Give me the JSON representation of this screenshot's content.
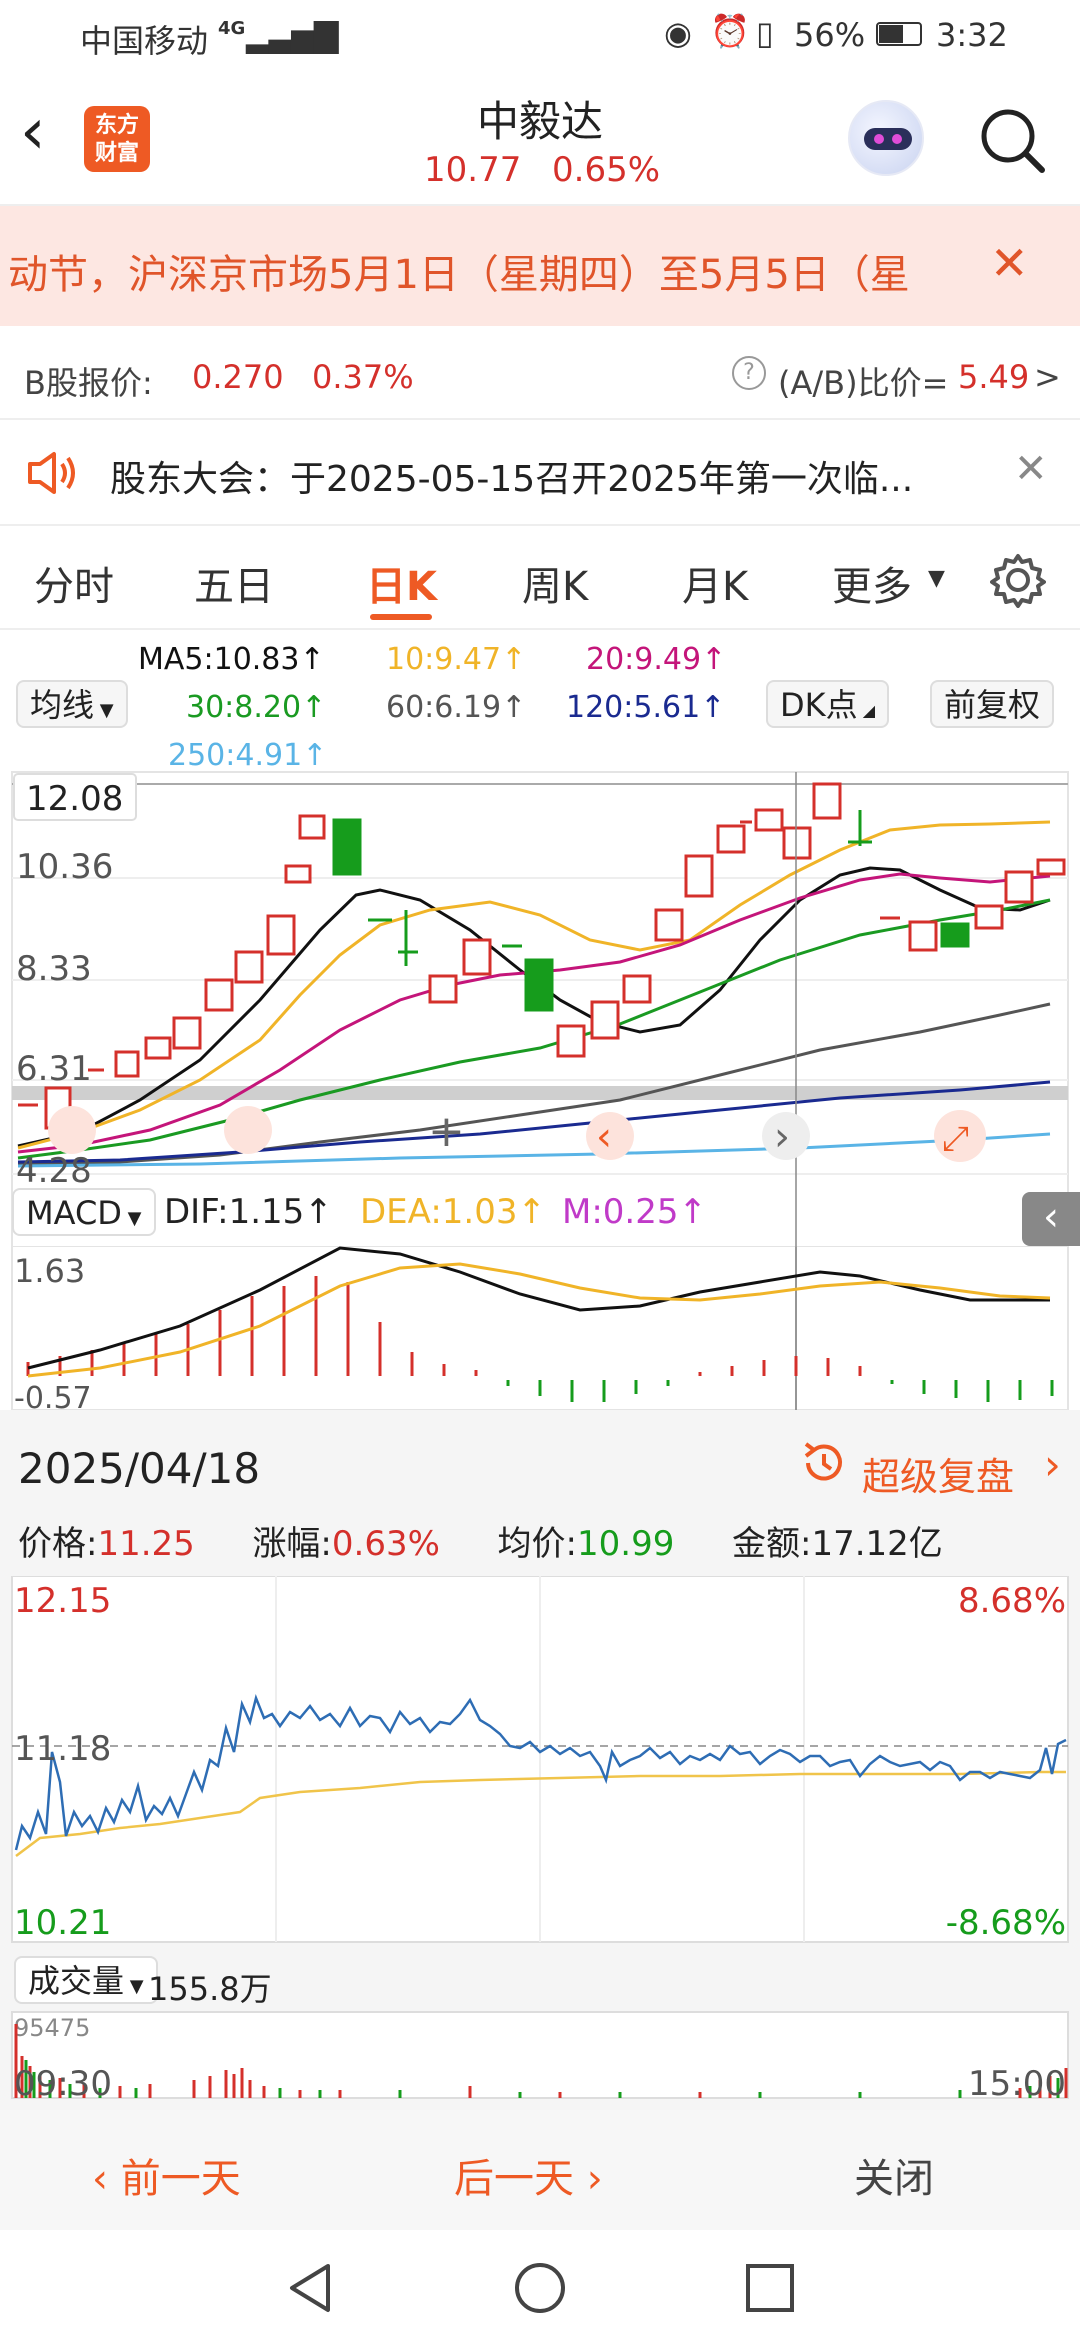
{
  "status": {
    "carrier": "中国移动",
    "network": "4G",
    "battery": "56%",
    "time": "3:32"
  },
  "header": {
    "title": "中毅达",
    "price": "10.77",
    "change_pct": "0.65%",
    "logo_text_1": "东方",
    "logo_text_2": "财富"
  },
  "notice": {
    "text": "动节，沪深京市场5月1日（星期四）至5月5日（星"
  },
  "bquote": {
    "label": "B股报价:",
    "price": "0.270",
    "pct": "0.37%",
    "ratio_label": "(A/B)比价=",
    "ratio_value": "5.49",
    "arrow": ">"
  },
  "meeting": {
    "text": "股东大会：于2025-05-15召开2025年第一次临..."
  },
  "tabs": [
    "分时",
    "五日",
    "日K",
    "周K",
    "月K",
    "更多"
  ],
  "active_tab": "日K",
  "ma": {
    "ma5": "MA5:10.83↑",
    "ma10": "10:9.47↑",
    "ma20": "20:9.49↑",
    "ma30": "30:8.20↑",
    "ma60": "60:6.19↑",
    "ma120": "120:5.61↑",
    "ma250": "250:4.91↑",
    "selector": "均线",
    "dk": "DK点",
    "adjust": "前复权"
  },
  "kline": {
    "y_labels": [
      "12.08",
      "10.36",
      "8.33",
      "6.31",
      "4.28"
    ]
  },
  "macd": {
    "label": "MACD",
    "dif": "DIF:1.15↑",
    "dea": "DEA:1.03↑",
    "m": "M:0.25↑",
    "top": "1.63",
    "bottom": "-0.57"
  },
  "detail": {
    "date": "2025/04/18",
    "replay": "超级复盘",
    "price_label": "价格:",
    "price": "11.25",
    "chg_label": "涨幅:",
    "chg": "0.63%",
    "avg_label": "均价:",
    "avg": "10.99",
    "amt_label": "金额:",
    "amt": "17.12亿",
    "high": "12.15",
    "mid": "11.18",
    "low": "10.21",
    "high_pct": "8.68%",
    "low_pct": "-8.68%",
    "vol_label": "成交量",
    "vol": "155.8万",
    "vol_max": "95475",
    "time_start": "09:30",
    "time_end": "15:00"
  },
  "footer": {
    "prev": "前一天",
    "next": "后一天",
    "close": "关闭"
  },
  "colors": {
    "up": "#d4302b",
    "down": "#169c1c",
    "accent": "#ee5a24",
    "ma5": "#111111",
    "ma10": "#f0b428",
    "ma20": "#c4157a",
    "ma30": "#1a9a22",
    "ma60": "#555555",
    "ma120": "#1a2a90",
    "ma250": "#5ab4e6"
  }
}
